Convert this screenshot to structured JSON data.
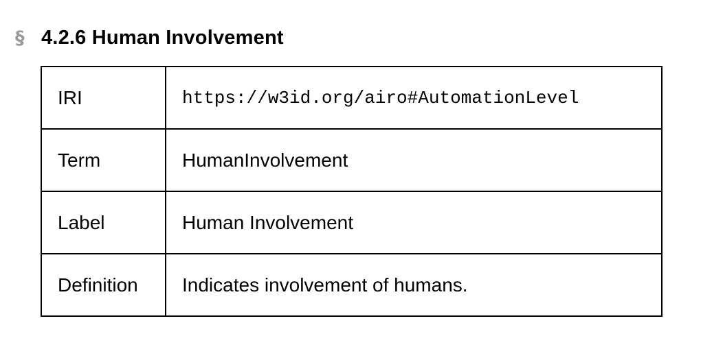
{
  "section": {
    "mark": "§",
    "title": "4.2.6 Human Involvement"
  },
  "table": {
    "rows": [
      {
        "key": "IRI",
        "value": "https://w3id.org/airo#AutomationLevel"
      },
      {
        "key": "Term",
        "value": "HumanInvolvement"
      },
      {
        "key": "Label",
        "value": "Human Involvement"
      },
      {
        "key": "Definition",
        "value": "Indicates involvement of humans."
      }
    ]
  }
}
